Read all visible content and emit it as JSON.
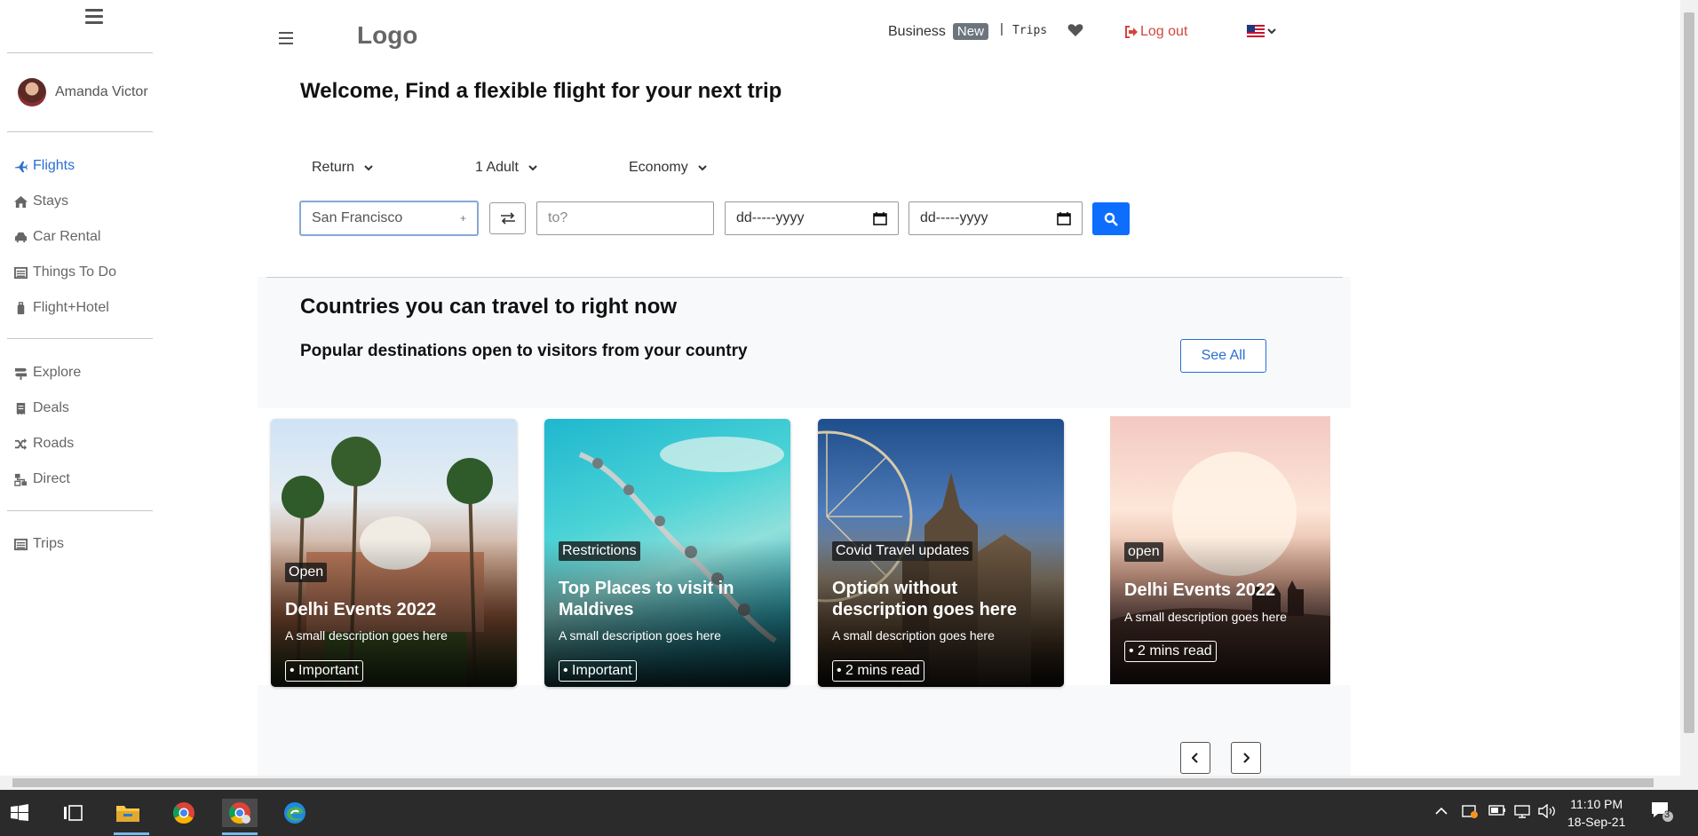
{
  "sidebar": {
    "user_name": "Amanda Victor",
    "items": [
      {
        "label": "Flights"
      },
      {
        "label": "Stays"
      },
      {
        "label": "Car Rental"
      },
      {
        "label": "Things To Do"
      },
      {
        "label": "Flight+Hotel"
      },
      {
        "label": "Explore"
      },
      {
        "label": "Deals"
      },
      {
        "label": "Roads"
      },
      {
        "label": "Direct"
      },
      {
        "label": "Trips"
      }
    ],
    "active_color": "#2a6fd1"
  },
  "header": {
    "logo": "Logo",
    "business": "Business",
    "badge": "New",
    "separator": "|",
    "trips": "Trips",
    "logout": "Log out",
    "logout_color": "#d6453d"
  },
  "search": {
    "welcome": "Welcome, Find a flexible flight for your next trip",
    "trip_type": "Return",
    "passengers": "1 Adult",
    "cabin": "Economy",
    "from_value": "San Francisco",
    "from_plus": "+",
    "to_placeholder": "to?",
    "date1": "dd-----yyyy",
    "date2": "dd-----yyyy",
    "button_color": "#0d6efd"
  },
  "destinations": {
    "heading": "Countries you can travel to right now",
    "subheading": "Popular destinations open to visitors from your country",
    "see_all": "See All",
    "cards": [
      {
        "tag": "Open",
        "title": "Delhi Events 2022",
        "desc": "A small description goes here",
        "pill": "• Important"
      },
      {
        "tag": "Restrictions",
        "title": "Top Places to visit in Maldives",
        "desc": "A small description goes here",
        "pill": "• Important"
      },
      {
        "tag": "Covid Travel updates",
        "title": "Option without description goes here",
        "desc": "A small description goes here",
        "pill": "• 2 mins read"
      },
      {
        "tag": "open",
        "title": "Delhi Events 2022",
        "desc": "A small description goes here",
        "pill": "• 2 mins read"
      }
    ]
  },
  "taskbar": {
    "time": "11:10 PM",
    "date": "18-Sep-21",
    "notifications": "3"
  }
}
